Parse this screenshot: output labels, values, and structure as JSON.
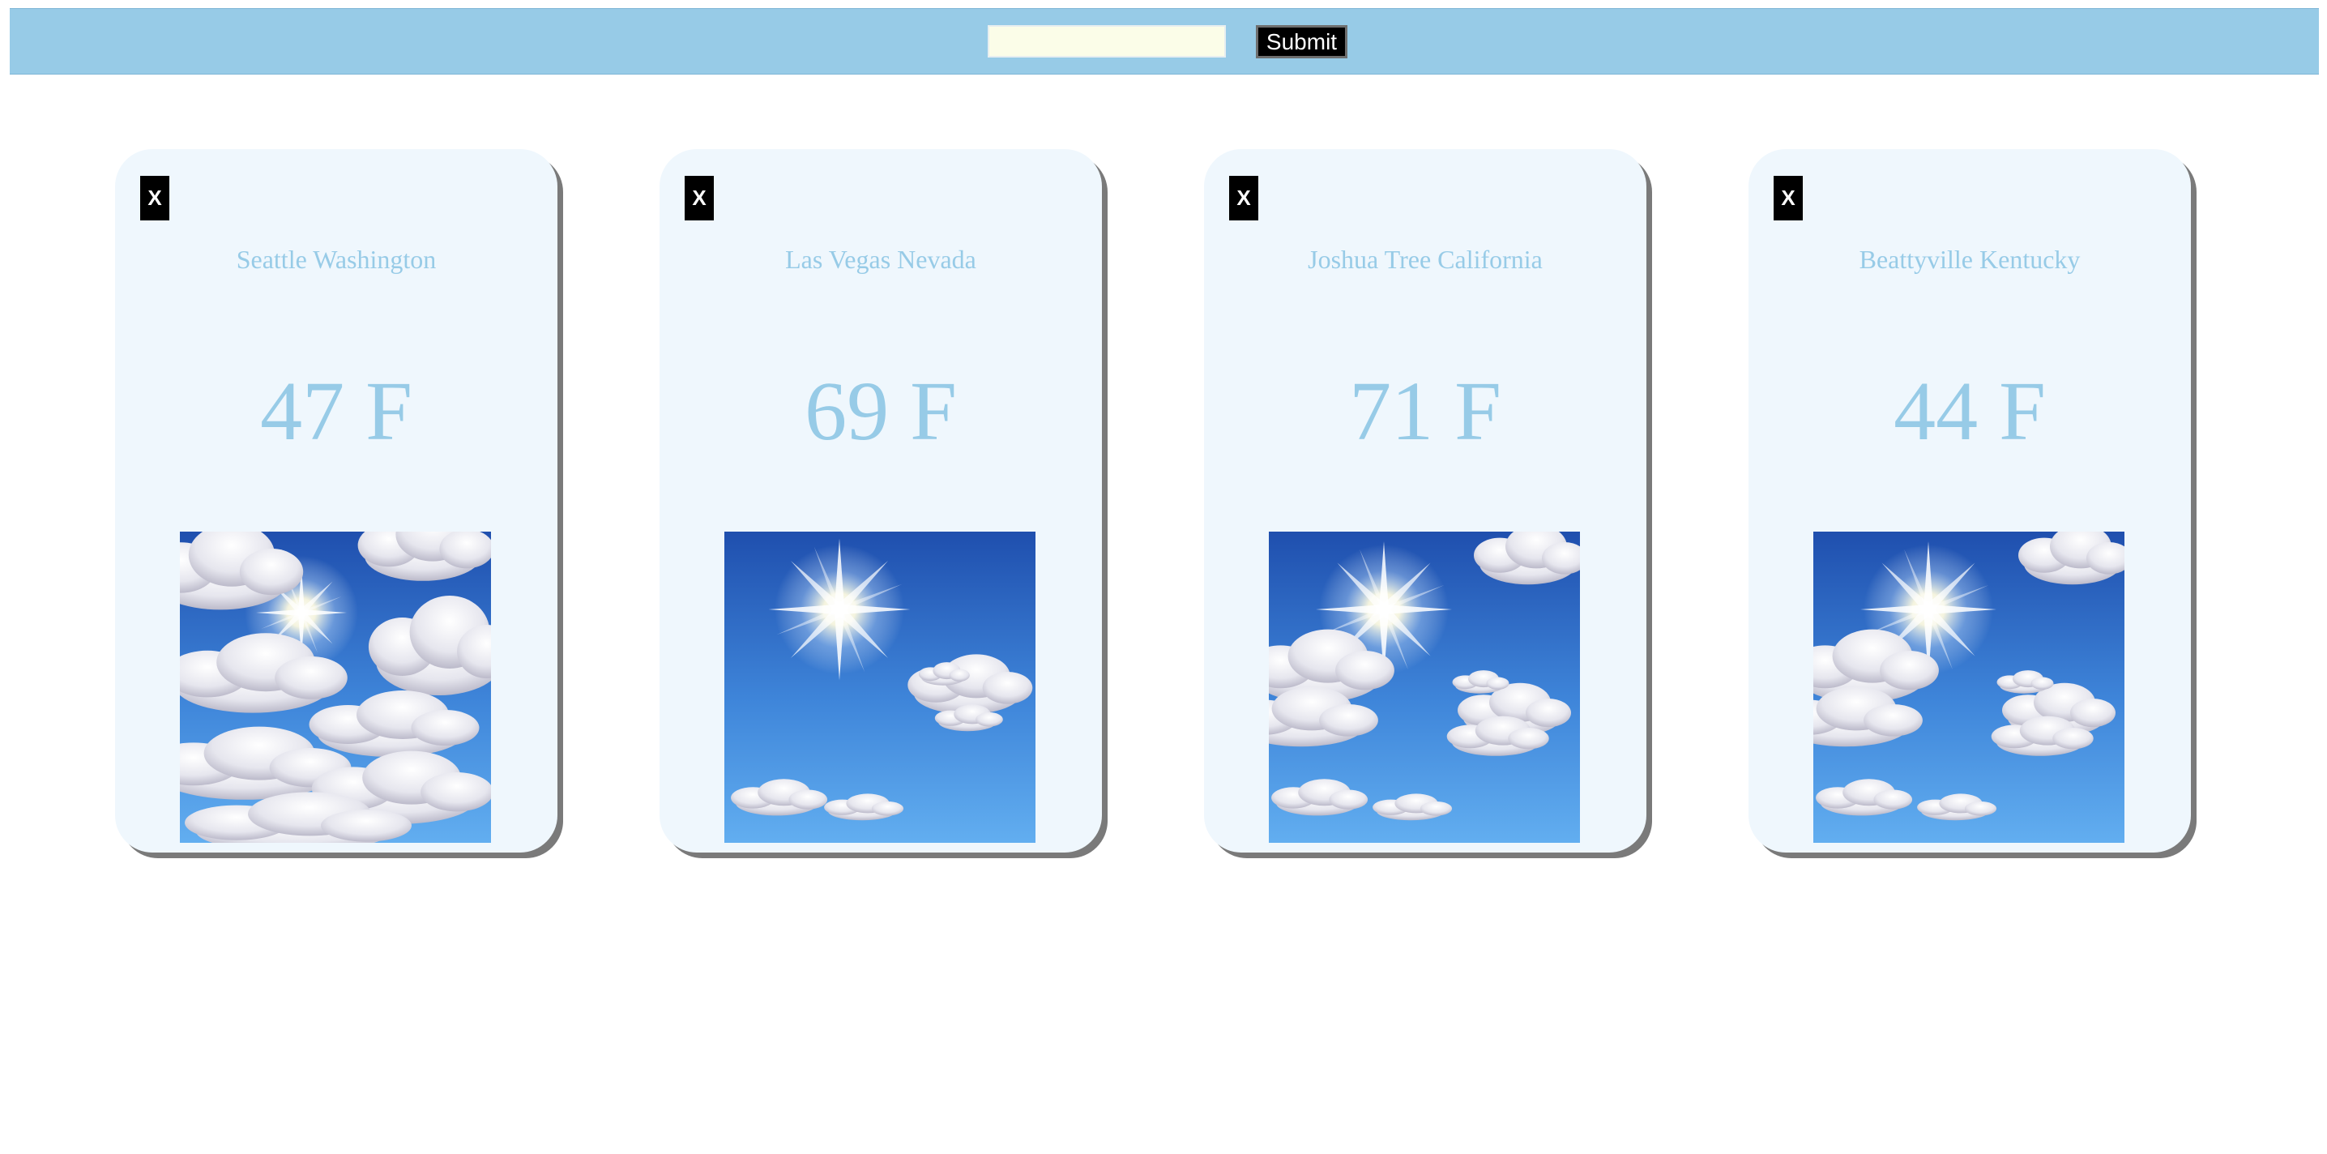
{
  "search": {
    "value": "",
    "placeholder": ""
  },
  "toolbar": {
    "submit_label": "Submit"
  },
  "cards": [
    {
      "close_label": "X",
      "city": "Seattle Washington",
      "temp": "47 F",
      "condition_icon": "cloudy-sun-icon"
    },
    {
      "close_label": "X",
      "city": "Las Vegas Nevada",
      "temp": "69 F",
      "condition_icon": "sunny-icon"
    },
    {
      "close_label": "X",
      "city": "Joshua Tree California",
      "temp": "71 F",
      "condition_icon": "partly-cloudy-icon"
    },
    {
      "close_label": "X",
      "city": "Beattyville Kentucky",
      "temp": "44 F",
      "condition_icon": "partly-cloudy-icon"
    }
  ],
  "colors": {
    "accent": "#97cbe7",
    "card_bg": "#eff7fd",
    "input_bg": "#fbfde8",
    "button_bg": "#000000"
  }
}
